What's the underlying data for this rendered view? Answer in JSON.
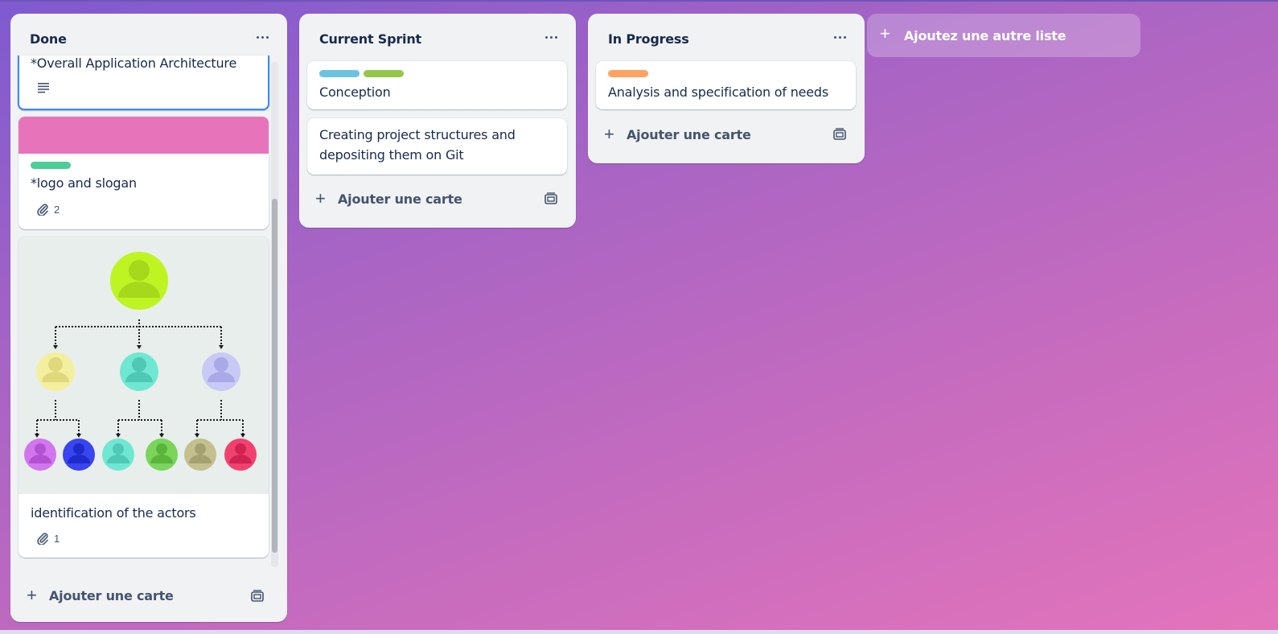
{
  "lists": [
    {
      "title": "Done",
      "cards": [
        {
          "title": "*Overall Application Architecture",
          "has_description": true
        },
        {
          "cover_color": "#e774bb",
          "labels": [
            "#4bce97"
          ],
          "title": "*logo and slogan",
          "attachments": "2"
        },
        {
          "cover": "org-chart-image",
          "title": "identification of the actors",
          "attachments": "1"
        }
      ],
      "add_card_label": "Ajouter une carte"
    },
    {
      "title": "Current Sprint",
      "cards": [
        {
          "labels": [
            "#6cc3e0",
            "#94c748"
          ],
          "title": "Conception"
        },
        {
          "title_lines": [
            "Creating project structures and",
            "depositing them on Git"
          ]
        }
      ],
      "add_card_label": "Ajouter une carte"
    },
    {
      "title": "In Progress",
      "cards": [
        {
          "labels": [
            "#fea362"
          ],
          "title": "Analysis and specification of needs"
        }
      ],
      "add_card_label": "Ajouter une carte"
    }
  ],
  "add_list_label": "Ajoutez une autre liste",
  "icons": {
    "menu": "ellipsis-icon",
    "add": "plus-icon",
    "template": "card-template-icon",
    "description": "description-icon",
    "attachment": "paperclip-icon"
  }
}
